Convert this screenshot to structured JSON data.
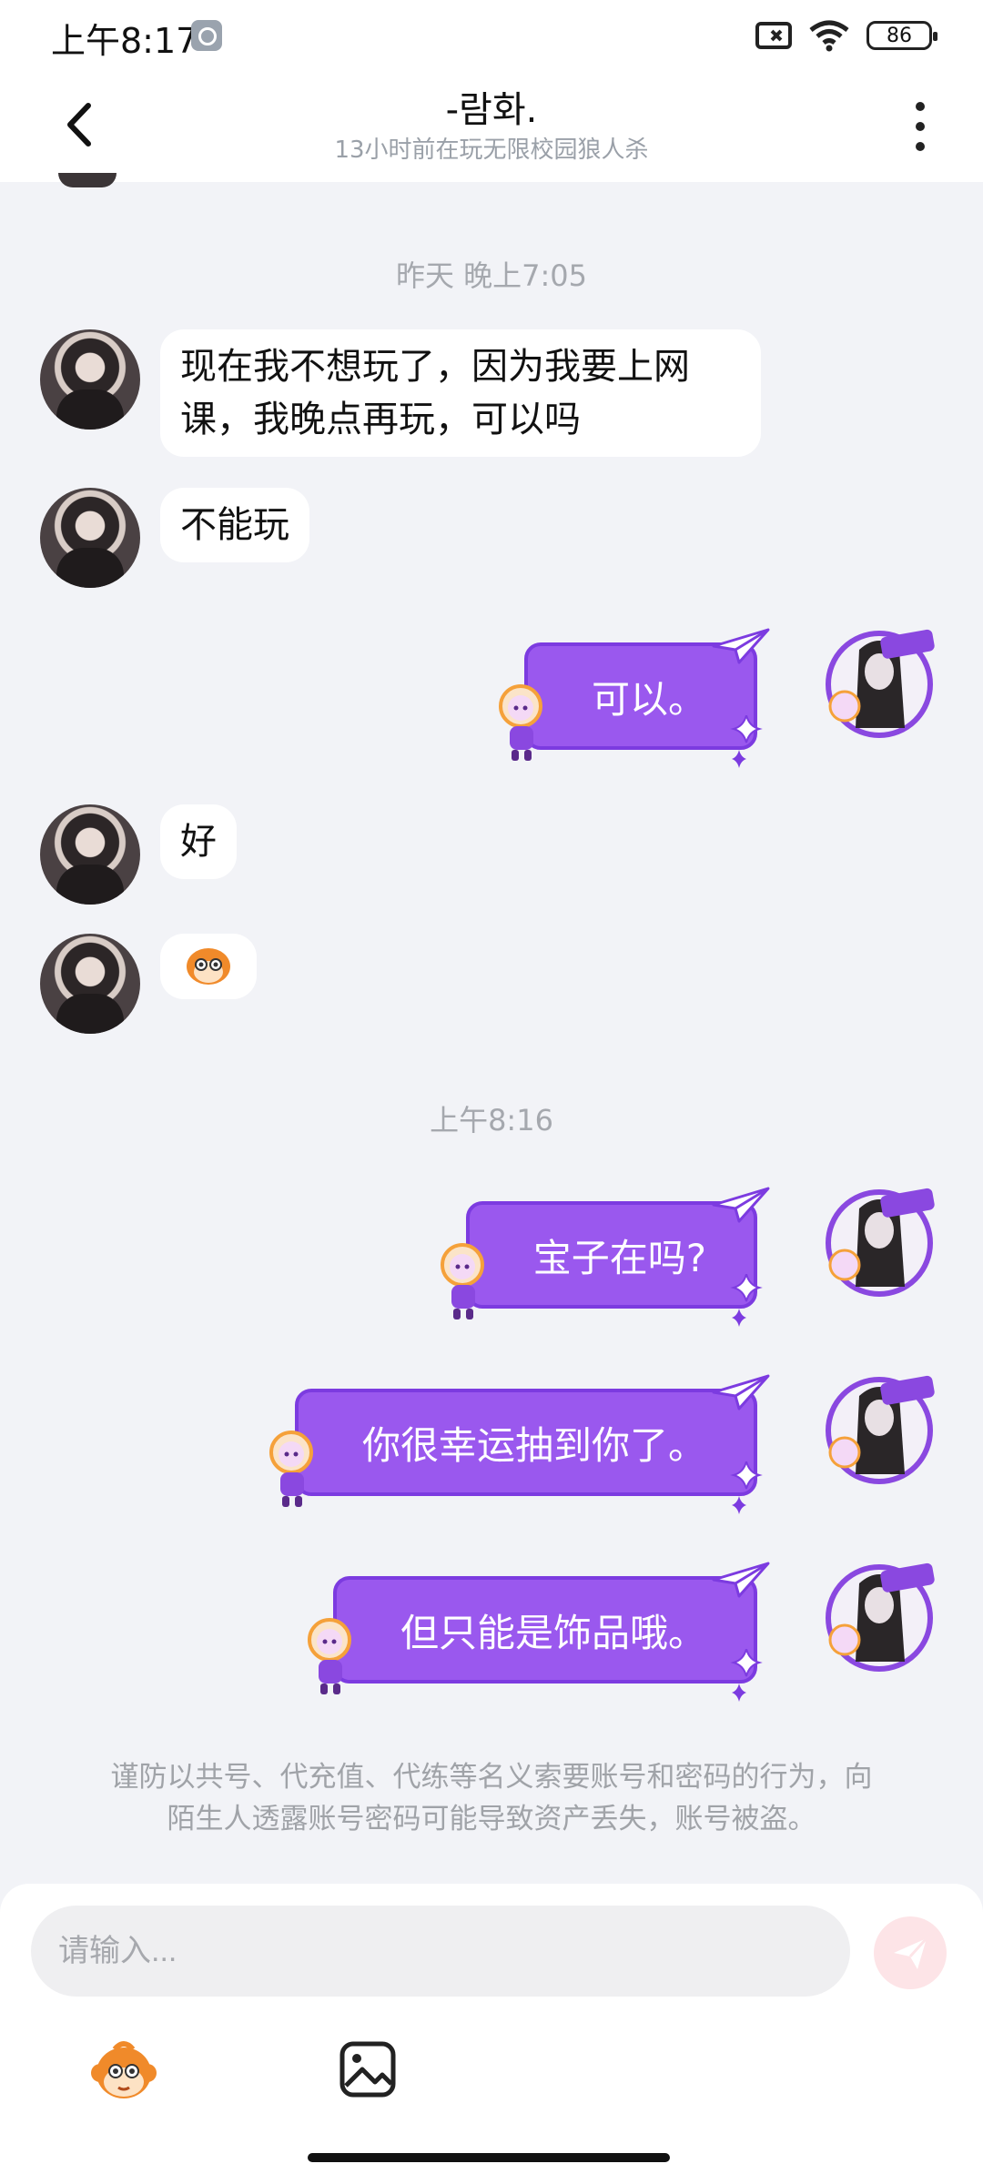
{
  "status_bar": {
    "time": "上午8:17",
    "battery": "86"
  },
  "header": {
    "title": "-람화.",
    "subtitle": "13小时前在玩无限校园狼人杀"
  },
  "timestamps": {
    "first": "昨天 晚上7:05",
    "second": "上午8:16"
  },
  "messages": {
    "m1": {
      "line1": "现在我不想玩了，因为我要上网",
      "line2": "课，我晚点再玩，可以吗"
    },
    "m2": "不能玩",
    "m3": "可以。",
    "m4": "好",
    "m6": "宝子在吗?",
    "m7": "你很幸运抽到你了。",
    "m8": "但只能是饰品哦。"
  },
  "disclaimer": {
    "line1": "谨防以共号、代充值、代练等名义索要账号和密码的行为，向",
    "line2": "陌生人透露账号密码可能导致资产丢失，账号被盗。"
  },
  "input": {
    "placeholder": "请输入..."
  },
  "colors": {
    "accent_purple": "#9a58ee",
    "send_pink": "#fde4e7"
  }
}
